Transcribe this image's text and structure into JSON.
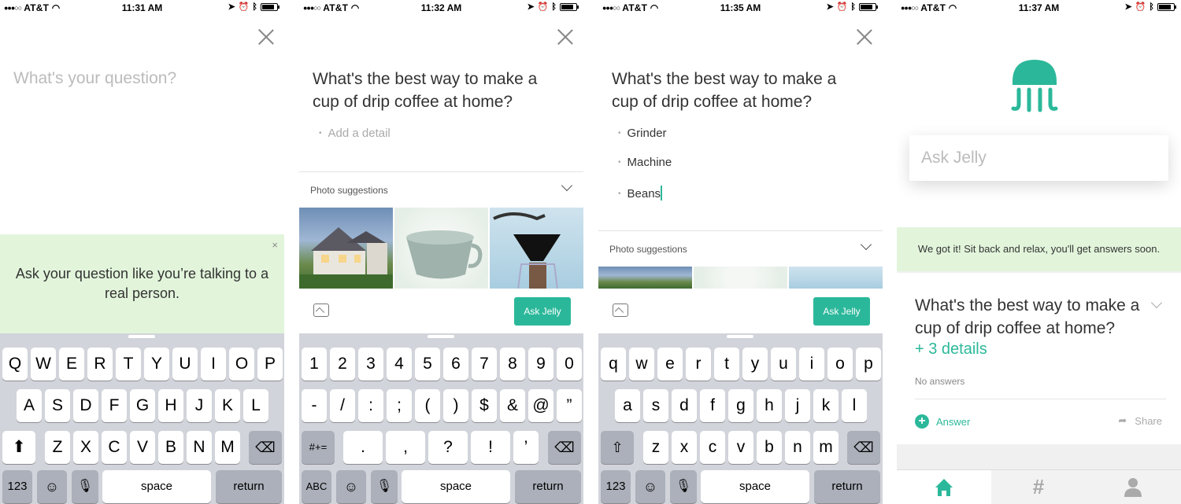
{
  "status_bar": {
    "carrier": "AT&T",
    "times": [
      "11:31 AM",
      "11:32 AM",
      "11:35 AM",
      "11:37 AM"
    ]
  },
  "screen1": {
    "placeholder": "What's your question?",
    "tip": "Ask your question like you’re talking to a real person.",
    "tip_close": "×"
  },
  "question": "What's the best way to make a cup of drip coffee at home?",
  "screen2": {
    "detail_placeholder": "Add a detail"
  },
  "screen3": {
    "details": [
      "Grinder",
      "Machine",
      "Beans"
    ]
  },
  "photo_suggestions_label": "Photo suggestions",
  "ask_button": "Ask Jelly",
  "keyboard": {
    "row1_upper": [
      "Q",
      "W",
      "E",
      "R",
      "T",
      "Y",
      "U",
      "I",
      "O",
      "P"
    ],
    "row2_upper": [
      "A",
      "S",
      "D",
      "F",
      "G",
      "H",
      "J",
      "K",
      "L"
    ],
    "row3_upper": [
      "Z",
      "X",
      "C",
      "V",
      "B",
      "N",
      "M"
    ],
    "row1_num": [
      "1",
      "2",
      "3",
      "4",
      "5",
      "6",
      "7",
      "8",
      "9",
      "0"
    ],
    "row2_num": [
      "-",
      "/",
      ":",
      ";",
      "(",
      ")",
      "$",
      "&",
      "@",
      "”"
    ],
    "row3_num": [
      ".",
      ",",
      "?",
      "!",
      "’"
    ],
    "row1_lower": [
      "q",
      "w",
      "e",
      "r",
      "t",
      "y",
      "u",
      "i",
      "o",
      "p"
    ],
    "row2_lower": [
      "a",
      "s",
      "d",
      "f",
      "g",
      "h",
      "j",
      "k",
      "l"
    ],
    "row3_lower": [
      "z",
      "x",
      "c",
      "v",
      "b",
      "n",
      "m"
    ],
    "num_key": "123",
    "abc_key": "ABC",
    "sym_key": "#+=",
    "space": "space",
    "return": "return"
  },
  "screen4": {
    "ask_placeholder": "Ask Jelly",
    "banner": "We got it! Sit back and relax, you'll get answers soon.",
    "details_link": "+ 3 details",
    "no_answers": "No answers",
    "answer_button": "Answer",
    "share_button": "Share"
  },
  "colors": {
    "accent": "#2bb89a",
    "tip_bg": "#e2f5db",
    "keyboard_bg": "#d1d4da"
  }
}
